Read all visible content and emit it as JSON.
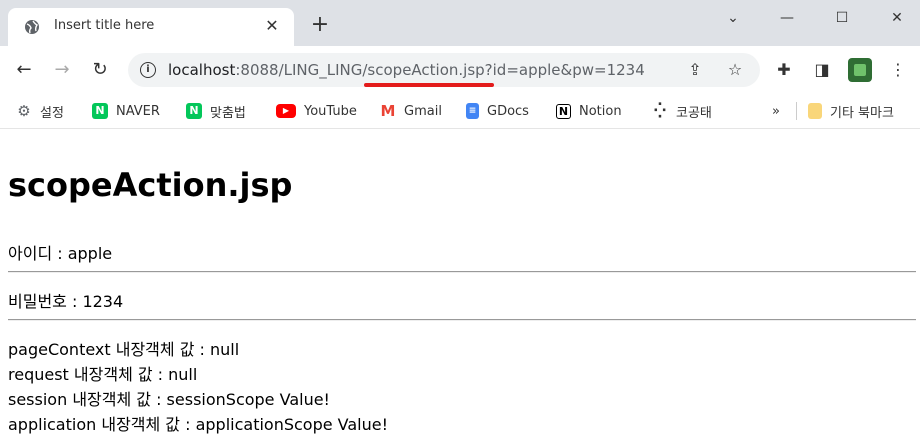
{
  "browser": {
    "tab_title": "Insert title here",
    "new_tab": "+",
    "url_host": "localhost",
    "url_rest": ":8088/LING_LING/scopeAction.jsp?id=apple&pw=1234",
    "window_controls": [
      "⌄",
      "—",
      "☐",
      "✕"
    ]
  },
  "bookmarks": [
    {
      "label": "설정",
      "icon": "gear-icon",
      "color": "#5f6368"
    },
    {
      "label": "NAVER",
      "icon": "naver-icon",
      "color": "#03c75a"
    },
    {
      "label": "맞춤법",
      "icon": "naver-icon",
      "color": "#03c75a"
    },
    {
      "label": "YouTube",
      "icon": "youtube-icon",
      "color": "#ff0000"
    },
    {
      "label": "Gmail",
      "icon": "gmail-icon",
      "color": "#ea4335"
    },
    {
      "label": "GDocs",
      "icon": "docs-icon",
      "color": "#4285f4"
    },
    {
      "label": "Notion",
      "icon": "notion-icon",
      "color": "#000000"
    },
    {
      "label": "코공태",
      "icon": "dots-icon",
      "color": "#333333"
    }
  ],
  "bookmarks_more": "»",
  "other_bookmarks": "기타 북마크",
  "page": {
    "heading": "scopeAction.jsp",
    "id_line": "아이디 : apple",
    "pw_line": "비밀번호 : 1234",
    "scopes": [
      "pageContext 내장객체 값 : null",
      "request 내장객체 값 : null",
      "session 내장객체 값 : sessionScope Value!",
      "application 내장객체 값 : applicationScope Value!"
    ]
  }
}
